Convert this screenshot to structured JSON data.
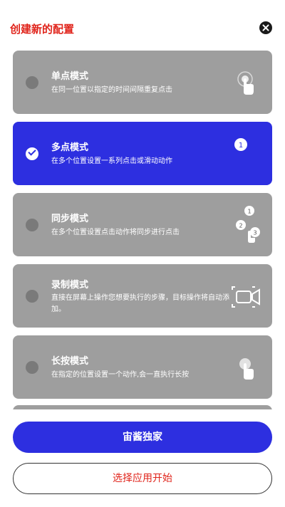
{
  "header": {
    "title": "创建新的配置"
  },
  "modes": [
    {
      "name": "单点模式",
      "desc": "在同一位置以指定的时间间隔重复点击",
      "selected": false,
      "icon": "single-tap-icon"
    },
    {
      "name": "多点模式",
      "desc": "在多个位置设置一系列点击或滑动动作",
      "selected": true,
      "icon": "multi-tap-icon",
      "badge": "1"
    },
    {
      "name": "同步模式",
      "desc": "在多个位置设置点击动作将同步进行点击",
      "selected": false,
      "icon": "sync-tap-icon",
      "badges": [
        "1",
        "2",
        "3"
      ]
    },
    {
      "name": "录制模式",
      "desc": "直接在屏幕上操作您想要执行的步骤，目标操作将自动添加。",
      "selected": false,
      "icon": "video-record-icon"
    },
    {
      "name": "长按模式",
      "desc": "在指定的位置设置一个动作,会一直执行长按",
      "selected": false,
      "icon": "long-press-icon"
    }
  ],
  "actions": {
    "primary_label": "宙酱独家",
    "secondary_label": "选择应用开始"
  },
  "colors": {
    "accent": "#2d2fe0",
    "title_red": "#e0241b",
    "card_gray": "#9e9e9e"
  }
}
